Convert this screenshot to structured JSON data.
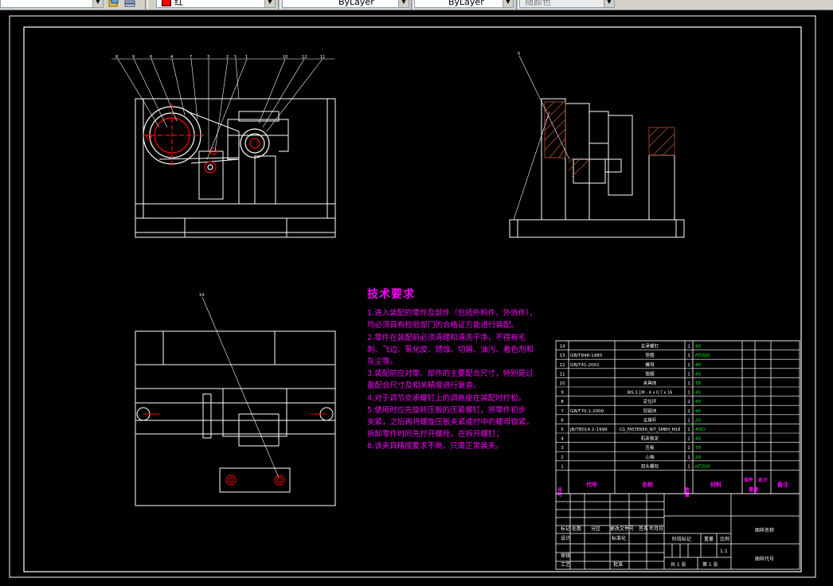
{
  "toolbar": {
    "color_select": "红",
    "linetype_select": "ByLayer",
    "lineweight_select": "ByLayer",
    "plotstyle_select": "随颜色"
  },
  "colors": {
    "drawing_line": "#ffffff",
    "technical_text": "#ff00ff",
    "bom_text": "#ffffff",
    "material_text": "#00ff00",
    "hatch": "#c05030",
    "center_line": "#ff0000",
    "leader_number": "#ffffff"
  },
  "views": {
    "front_leaders": [
      "8",
      "9",
      "6",
      "4",
      "7",
      "3",
      "2",
      "5",
      "1",
      "10",
      "12",
      "11"
    ],
    "side_leaders": [
      "5"
    ],
    "top_leaders": [
      "14"
    ]
  },
  "technical_requirements": {
    "title": "技术要求",
    "items": [
      "1.进入装配的零件及部件（包括外购件、外协件），",
      "均必须具有检验部门的合格证方能进行装配。",
      "2.零件在装配前必须清理和清洗干净，不得有毛",
      "刺、飞边、氧化皮、锈蚀、切屑、油污、着色剂和",
      "灰尘等。",
      "3.装配前应对零、部件的主要配合尺寸，特别是过",
      "盈配合尺寸及相关精度进行复查。",
      "4.对于调节支承螺钉上的调高座在装配时拧松。",
      "5.使用时应先旋转压板的压紧螺钉，将零件初步",
      "夹紧，之后再将螺旋压板夹紧或拧中的螺母锁紧，",
      "拆卸零件时同先拧开螺栓，在拆开螺钉；",
      "6.该夹具精度要求不高，只需正常装夹。"
    ]
  },
  "bom": {
    "header": {
      "no": "序号",
      "code": "代号",
      "name": "名称",
      "qty": "数量",
      "material": "材料",
      "single": "单件",
      "total": "总计",
      "weight": "重量",
      "remark": "备注"
    },
    "rows": [
      {
        "no": "14",
        "code": "",
        "name": "支承螺钉",
        "qty": "2",
        "material": "45"
      },
      {
        "no": "13",
        "code": "GB/T848-1985",
        "name": "垫圈",
        "qty": "1",
        "material": "HT200"
      },
      {
        "no": "12",
        "code": "GB/T41-2001",
        "name": "螺母",
        "qty": "1",
        "material": "45"
      },
      {
        "no": "11",
        "code": "",
        "name": "垫圈",
        "qty": "1",
        "material": "45"
      },
      {
        "no": "10",
        "code": "",
        "name": "夹具体",
        "qty": "1",
        "material": "T8"
      },
      {
        "no": "9",
        "code": "",
        "name": "BIS.3.1M - 4 x 0.7 x 16",
        "qty": "1",
        "material": "45"
      },
      {
        "no": "8",
        "code": "",
        "name": "定位环",
        "qty": "2",
        "material": "45"
      },
      {
        "no": "7",
        "code": "GB/T70.1-2000",
        "name": "铰链块",
        "qty": "2",
        "material": "45"
      },
      {
        "no": "6",
        "code": "",
        "name": "支撑杆",
        "qty": "1",
        "material": "20"
      },
      {
        "no": "5",
        "code": "JB/T8014.2-1999",
        "name": "CG_FASTENER_NIT_SMBH_M18",
        "qty": "1",
        "material": "40Cr"
      },
      {
        "no": "4",
        "code": "",
        "name": "机床锁定",
        "qty": "1",
        "material": "45"
      },
      {
        "no": "3",
        "code": "",
        "name": "压板",
        "qty": "1",
        "material": "T8"
      },
      {
        "no": "2",
        "code": "",
        "name": "心轴",
        "qty": "1",
        "material": "20"
      },
      {
        "no": "1",
        "code": "",
        "name": "双头螺栓",
        "qty": "1",
        "material": "HT200"
      }
    ]
  },
  "title_block": {
    "row1": [
      "标记",
      "处数",
      "分区",
      "更改文件号",
      "签名",
      "年月日"
    ],
    "design": "设计",
    "standard": "标准化",
    "review": "审核",
    "craft": "工艺",
    "approve": "批准",
    "stage_mark": "阶段标记",
    "weight": "重量",
    "scale": "比例",
    "scale_value": "1:1",
    "sheets": "共 1 张",
    "sheet_no": "第 1 张",
    "drawing_name": "图样名称",
    "drawing_code": "图样代号"
  }
}
